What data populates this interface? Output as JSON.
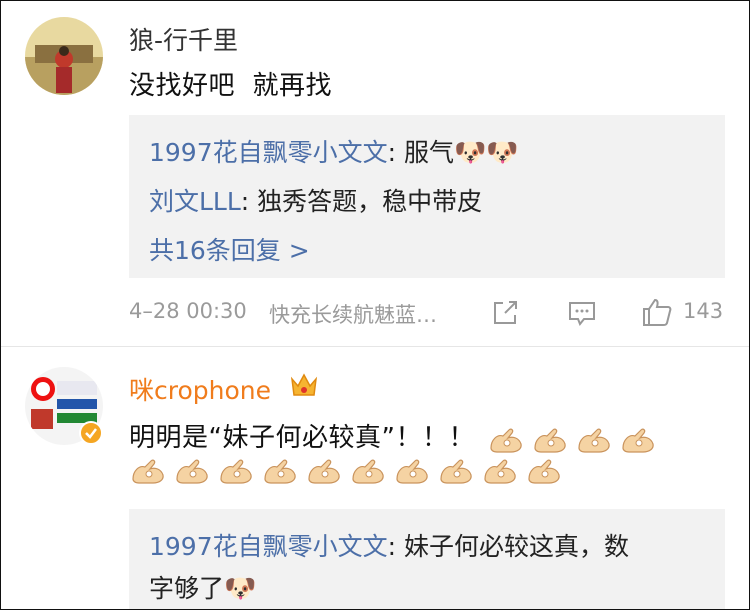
{
  "comment1": {
    "username": "狼-行千里",
    "text": "没找好吧  就再找",
    "replies": [
      {
        "name": "1997花自飘零小文文",
        "text": ": 服气",
        "emojis": [
          "🐶",
          "🐶"
        ]
      },
      {
        "name": "刘文LLL",
        "text": ": 独秀答题，稳中带皮"
      }
    ],
    "more_replies": "共16条回复 >",
    "meta_time": "4–28 00:30",
    "meta_source": "快充长续航魅蓝…",
    "like_count": "143",
    "icons": [
      "share-icon",
      "comment-icon",
      "like-icon"
    ]
  },
  "comment2": {
    "username": "咪crophone",
    "username_color": "#f07c1c",
    "badge_icon": "crown-icon",
    "verified_color": "#f5a623",
    "text": "明明是“妹子何必较真”！！！",
    "hand_emoji_count_line1": 4,
    "hand_emoji_count_line2": 10,
    "replies": [
      {
        "name": "1997花自飘零小文文",
        "text": ": 妹子何必较这真，数",
        "text2": "字够了",
        "emojis": [
          "🐶"
        ]
      }
    ]
  }
}
